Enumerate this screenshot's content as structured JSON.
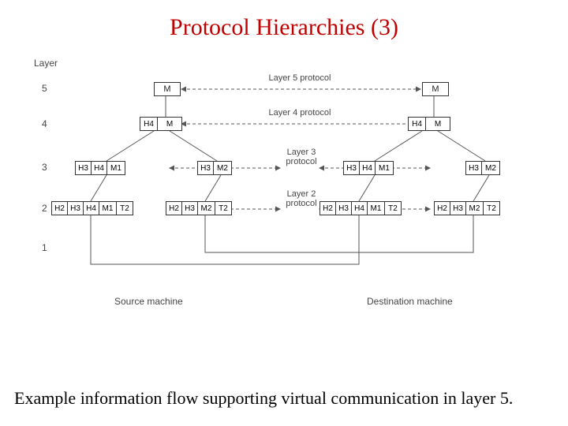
{
  "title": "Protocol Hierarchies (3)",
  "caption": "Example information flow supporting virtual communication in layer 5.",
  "labels": {
    "layer_header": "Layer",
    "layers": [
      "5",
      "4",
      "3",
      "2",
      "1"
    ],
    "source": "Source machine",
    "dest": "Destination machine"
  },
  "protocols": {
    "p5": "Layer 5 protocol",
    "p4": "Layer 4 protocol",
    "p3": "Layer 3 protocol",
    "p2": "Layer 2 protocol"
  },
  "cells": {
    "M": "M",
    "H4": "H4",
    "H3": "H3",
    "H2": "H2",
    "M1": "M1",
    "M2": "M2",
    "T2": "T2"
  }
}
